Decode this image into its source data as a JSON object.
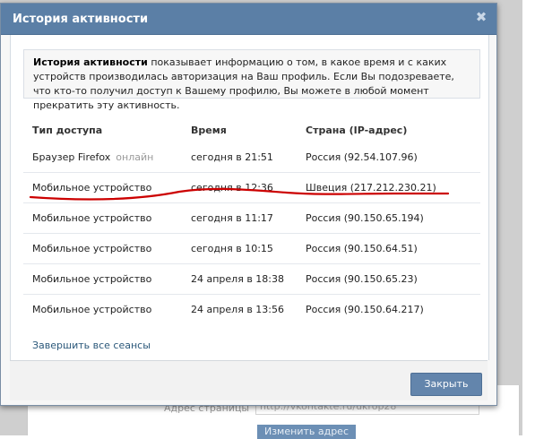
{
  "dialog": {
    "title": "История активности",
    "close_icon": "close-icon",
    "info_bold": "История активности",
    "info_text": " показывает информацию о том, в какое время и с каких устройств производилась авторизация на Ваш профиль. Если Вы подозреваете, что кто-то получил доступ к Вашему профилю, Вы можете в любой момент прекратить эту активность.",
    "columns": {
      "access": "Тип доступа",
      "time": "Время",
      "country": "Страна (IP-адрес)"
    },
    "rows": [
      {
        "access": "Браузер Firefox",
        "status": "онлайн",
        "time": "сегодня в 21:51",
        "country": "Россия (92.54.107.96)"
      },
      {
        "access": "Мобильное устройство",
        "status": "",
        "time": "сегодня в 12:36",
        "country": "Швеция (217.212.230.21)"
      },
      {
        "access": "Мобильное устройство",
        "status": "",
        "time": "сегодня в 11:17",
        "country": "Россия (90.150.65.194)"
      },
      {
        "access": "Мобильное устройство",
        "status": "",
        "time": "сегодня в 10:15",
        "country": "Россия (90.150.64.51)"
      },
      {
        "access": "Мобильное устройство",
        "status": "",
        "time": "24 апреля в 18:38",
        "country": "Россия (90.150.65.23)"
      },
      {
        "access": "Мобильное устройство",
        "status": "",
        "time": "24 апреля в 13:56",
        "country": "Россия (90.150.64.217)"
      }
    ],
    "end_sessions": "Завершить все сеансы",
    "close_button": "Закрыть"
  },
  "background": {
    "address_label": "Адрес страницы",
    "address_value": "http://vkontakte.ru/ukrop28",
    "change_button": "Изменить адрес"
  },
  "colors": {
    "accent": "#5b7fa6",
    "link": "#2b587a",
    "annotation": "#cc0000"
  }
}
